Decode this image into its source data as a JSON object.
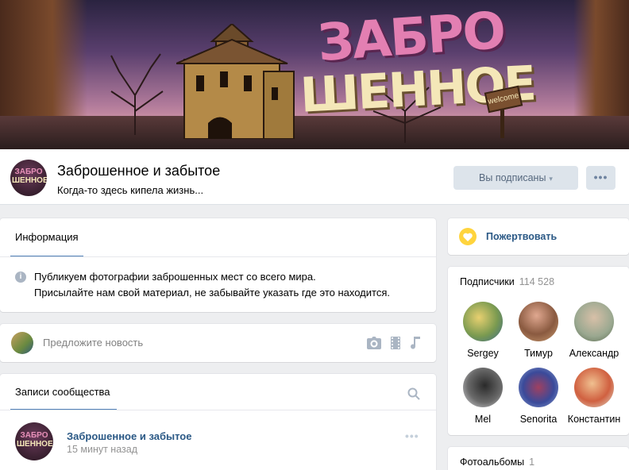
{
  "cover": {
    "logo_line1": "ЗАБРО",
    "logo_line2": "ШЕННОЕ",
    "sign_text": "welcome"
  },
  "group": {
    "name": "Заброшенное и забытое",
    "status": "Когда-то здесь кипела жизнь...",
    "avatar_text_top": "ЗАБРО",
    "avatar_text_bottom": "ШЕННОЕ",
    "subscribe_label": "Вы подписаны",
    "more_label": "•••"
  },
  "info": {
    "tab_label": "Информация",
    "line1": "Публикуем фотографии заброшенных мест со всего мира.",
    "line2": "Присылайте нам свой материал, не забывайте указать где это находится."
  },
  "suggest": {
    "placeholder": "Предложите новость",
    "icons": [
      "camera-icon",
      "video-icon",
      "music-icon"
    ]
  },
  "posts": {
    "tab_label": "Записи сообщества",
    "items": [
      {
        "author": "Заброшенное и забытое",
        "time": "15 минут назад",
        "more": "•••"
      }
    ]
  },
  "donate": {
    "label": "Пожертвовать"
  },
  "subscribers": {
    "title": "Подписчики",
    "count": "114 528",
    "members": [
      {
        "name": "Sergey",
        "color": "#8fb07a"
      },
      {
        "name": "Тимур",
        "color": "#c58a70"
      },
      {
        "name": "Александр",
        "color": "#9aa890"
      },
      {
        "name": "Mel",
        "color": "#c9c9cc"
      },
      {
        "name": "Senorita",
        "color": "#6a78b0"
      },
      {
        "name": "Константин",
        "color": "#d0805a"
      }
    ]
  },
  "albums": {
    "title": "Фотоальбомы",
    "count": "1"
  },
  "colors": {
    "accent": "#5181b8",
    "link": "#2a5885",
    "background": "#edeef0",
    "donate": "#ffd43d"
  }
}
